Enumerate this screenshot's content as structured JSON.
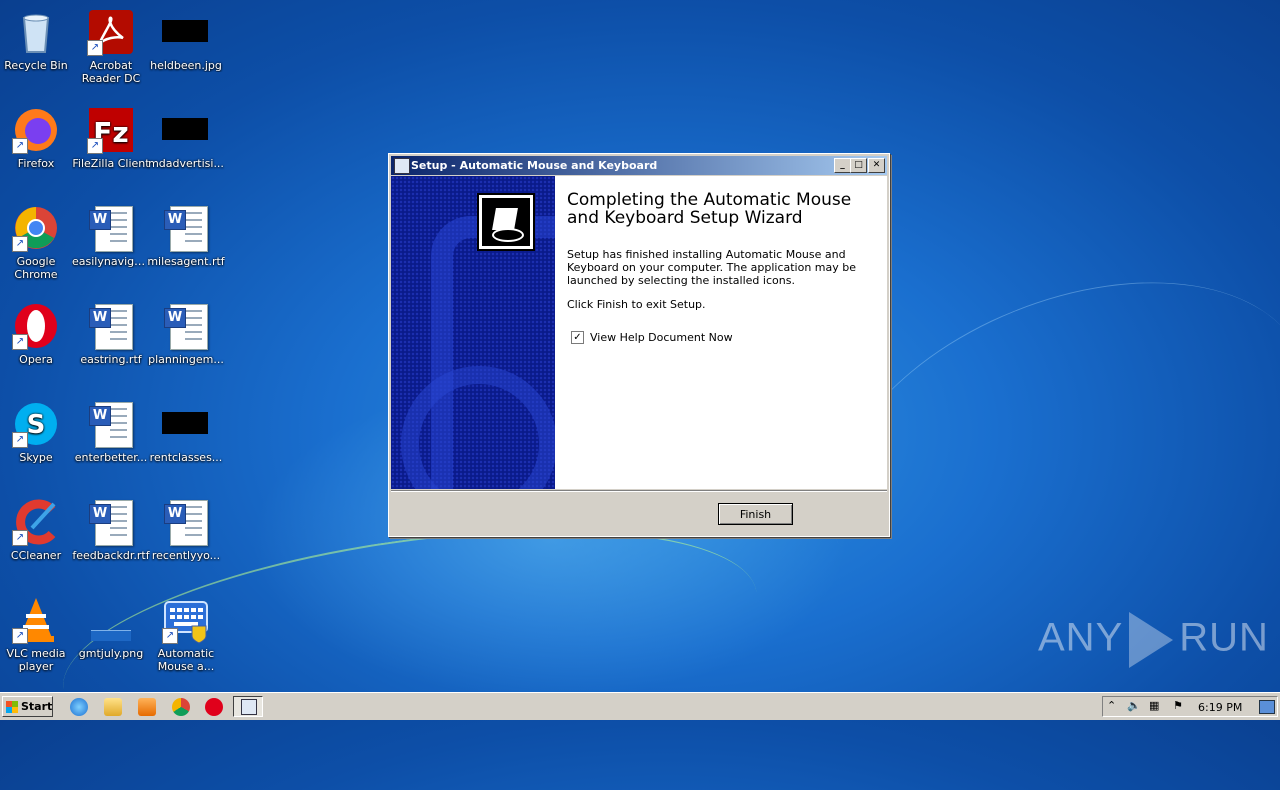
{
  "desktop": {
    "icons": [
      {
        "label": "Recycle Bin"
      },
      {
        "label": "Acrobat Reader DC"
      },
      {
        "label": "heldbeen.jpg"
      },
      {
        "label": "Firefox"
      },
      {
        "label": "FileZilla Client"
      },
      {
        "label": "mdadvertisi..."
      },
      {
        "label": "Google Chrome"
      },
      {
        "label": "easilynaviga..."
      },
      {
        "label": "milesagent.rtf"
      },
      {
        "label": "Opera"
      },
      {
        "label": "eastring.rtf"
      },
      {
        "label": "planningem..."
      },
      {
        "label": "Skype"
      },
      {
        "label": "enterbetter..."
      },
      {
        "label": "rentclasses..."
      },
      {
        "label": "CCleaner"
      },
      {
        "label": "feedbackdr.rtf"
      },
      {
        "label": "recentlyyo..."
      },
      {
        "label": "VLC media player"
      },
      {
        "label": "gmtjuly.png"
      },
      {
        "label": "Automatic Mouse a..."
      }
    ]
  },
  "dialog": {
    "title": "Setup - Automatic Mouse and Keyboard",
    "heading": "Completing the Automatic Mouse and Keyboard Setup Wizard",
    "body": "Setup has finished installing Automatic Mouse and Keyboard on your computer. The application may be launched by selecting the installed icons.",
    "exit_text": "Click Finish to exit Setup.",
    "checkbox_label": "View Help Document Now",
    "checkbox_checked": true,
    "finish_label": "Finish",
    "minimize": "_",
    "maximize": "□",
    "close": "✕"
  },
  "taskbar": {
    "start_label": "Start",
    "clock": "6:19 PM"
  },
  "watermark": {
    "left": "ANY",
    "right": "RUN"
  }
}
